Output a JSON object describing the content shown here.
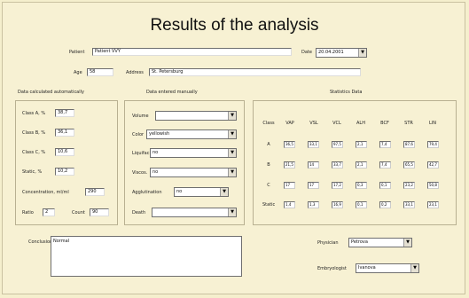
{
  "title": "Results of the analysis",
  "header": {
    "patient_label": "Patient",
    "patient_value": "Patient VVY",
    "date_label": "Date",
    "date_value": "20.04.2001",
    "age_label": "Age",
    "age_value": "58",
    "address_label": "Address",
    "address_value": "St. Petersburg"
  },
  "auto": {
    "heading": "Data calculated automatically",
    "fields": [
      {
        "label": "Class A, %",
        "value": "38,7"
      },
      {
        "label": "Class B, %",
        "value": "36,1"
      },
      {
        "label": "Class C, %",
        "value": "10,6"
      },
      {
        "label": "Static, %",
        "value": "10,2"
      },
      {
        "label": "Concentration, ml/ml",
        "value": "290"
      }
    ],
    "ratio_label": "Ratio",
    "ratio_value": "2",
    "count_label": "Count",
    "count_value": "90"
  },
  "manual": {
    "heading": "Data entered manually",
    "fields": [
      {
        "label": "Volume",
        "value": ""
      },
      {
        "label": "Color",
        "value": "yellowish"
      },
      {
        "label": "Liquifac.",
        "value": "no"
      },
      {
        "label": "Viscos.",
        "value": "no"
      },
      {
        "label": "Agglutination",
        "value": "no"
      },
      {
        "label": "Death",
        "value": ""
      }
    ]
  },
  "stats": {
    "heading": "Statistics Data",
    "columns": [
      "Class",
      "VAP",
      "VSL",
      "VCL",
      "ALH",
      "BCF",
      "STR",
      "LIN"
    ],
    "rows": [
      {
        "label": "A",
        "values": [
          "36,5",
          "33,1",
          "97,5",
          "2,1",
          "7,4",
          "87,6",
          "79,4"
        ]
      },
      {
        "label": "B",
        "values": [
          "21,5",
          "14",
          "33,7",
          "2,1",
          "7,4",
          "65,5",
          "42,7"
        ]
      },
      {
        "label": "C",
        "values": [
          "17",
          "17",
          "17,2",
          "0,3",
          "0,1",
          "23,2",
          "50,8"
        ]
      },
      {
        "label": "Static",
        "values": [
          "1,4",
          "1,3",
          "16,9",
          "0,1",
          "0,2",
          "33,1",
          "23,1"
        ]
      }
    ]
  },
  "conclusion": {
    "label": "Conclusion",
    "value": "Normal"
  },
  "physician": {
    "label": "Physician",
    "value": "Petrova"
  },
  "embryologist": {
    "label": "Embryologist",
    "value": "Ivanova"
  },
  "icons": {
    "dropdown": "chevron-down-icon"
  }
}
